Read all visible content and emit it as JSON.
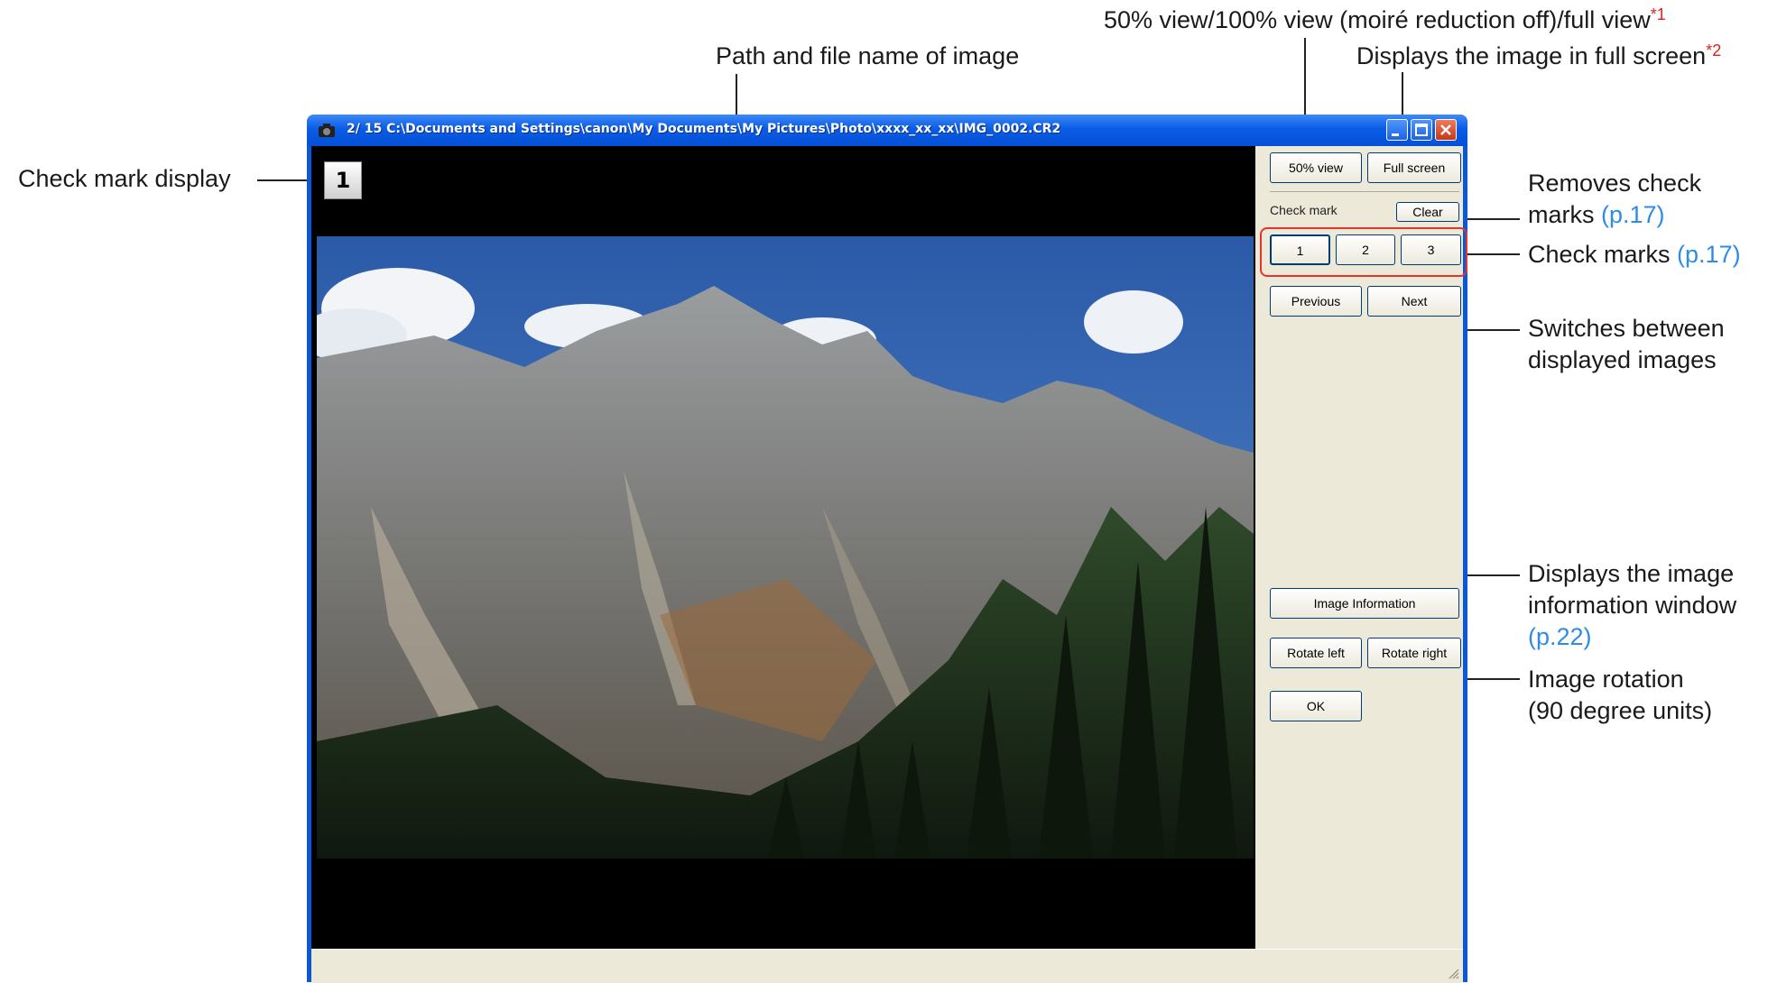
{
  "callouts": {
    "view_modes": "50% view/100% view (moiré reduction off)/full view",
    "view_modes_note": "*1",
    "full_screen": "Displays the image in full screen",
    "full_screen_note": "*2",
    "path": "Path and file name of image",
    "check_display": "Check mark display",
    "removes_line1": "Removes check",
    "removes_line2": "marks ",
    "removes_ref": "(p.17)",
    "check_marks": "Check marks ",
    "check_marks_ref": "(p.17)",
    "switch_line1": "Switches between",
    "switch_line2": "displayed images",
    "info_line1": "Displays the image",
    "info_line2": "information window",
    "info_ref": "(p.22)",
    "rotate_line1": "Image rotation",
    "rotate_line2": "(90 degree units)"
  },
  "window": {
    "title": "2/ 15  C:\\Documents and Settings\\canon\\My Documents\\My Pictures\\Photo\\xxxx_xx_xx\\IMG_0002.CR2",
    "check_badge": "1"
  },
  "panel": {
    "view50": "50% view",
    "fullscreen": "Full screen",
    "check_mark_label": "Check mark",
    "clear": "Clear",
    "mark1": "1",
    "mark2": "2",
    "mark3": "3",
    "previous": "Previous",
    "next": "Next",
    "image_info": "Image Information",
    "rotate_left": "Rotate left",
    "rotate_right": "Rotate right",
    "ok": "OK"
  },
  "colors": {
    "accent_red": "#e8332b",
    "link_blue": "#2f8be6",
    "titlebar_blue": "#0a58d8"
  }
}
